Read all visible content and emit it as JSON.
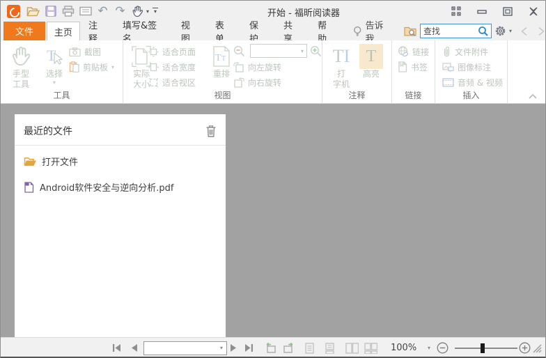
{
  "titlebar": {
    "title": "开始 - 福昕阅读器"
  },
  "tabs": {
    "file": "文件",
    "home": "主页",
    "comment": "注释",
    "fill_sign": "填写&签名",
    "view": "视图",
    "form": "表单",
    "protect": "保护",
    "share": "共享",
    "help": "帮助",
    "tell_me": "告诉我...",
    "search_placeholder": "查找"
  },
  "ribbon": {
    "tools": {
      "label": "工具",
      "hand": "手型\n工具",
      "select": "选择",
      "snapshot": "截图",
      "clipboard": "剪贴板"
    },
    "view": {
      "label": "视图",
      "actual_size": "实际\n大小",
      "fit_page": "适合页面",
      "fit_width": "适合宽度",
      "fit_visible": "适合视区",
      "reflow": "重排",
      "rotate_left": "向左旋转",
      "rotate_right": "向右旋转"
    },
    "comment": {
      "label": "注释",
      "typewriter": "打\n字机",
      "highlight": "高亮"
    },
    "links": {
      "label": "链接",
      "link": "链接",
      "bookmark": "书签"
    },
    "insert": {
      "label": "插入",
      "file_attachment": "文件附件",
      "image_annotation": "图像标注",
      "audio_video": "音频 & 视频"
    }
  },
  "recent": {
    "title": "最近的文件",
    "open_file": "打开文件",
    "file_name": "Android软件安全与逆向分析.pdf"
  },
  "status": {
    "zoom_level": "100%"
  },
  "colors": {
    "accent_orange": "#f0791e",
    "content_bg": "#a2a2a2",
    "highlight_bg": "#f8e8ce",
    "search_blue": "#2b8bd0",
    "folder_orange": "#e7a33c",
    "pdf_purple": "#7f63a5"
  }
}
